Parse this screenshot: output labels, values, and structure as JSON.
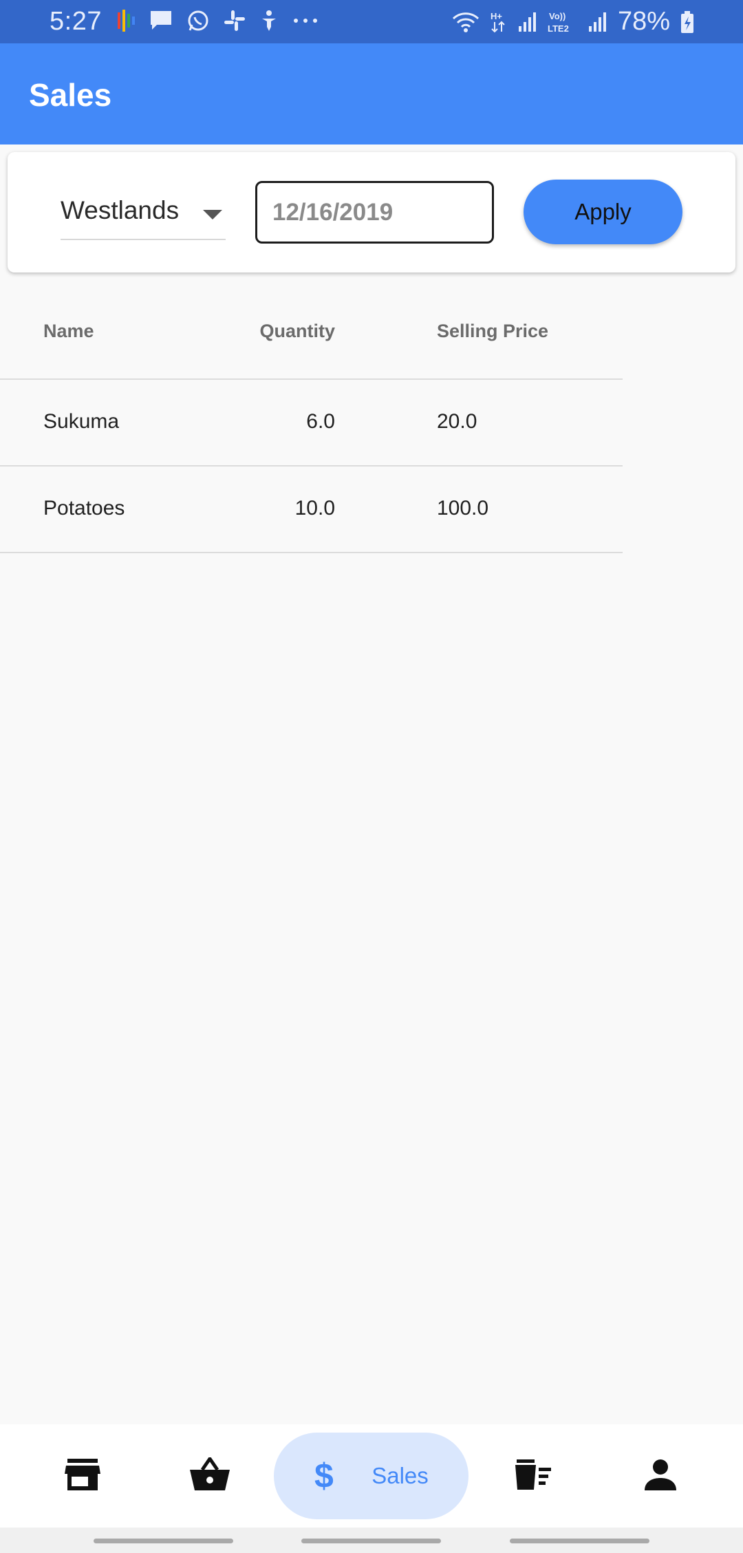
{
  "status_bar": {
    "time": "5:27",
    "battery": "78%",
    "left_icons": [
      "multicolor-app-icon",
      "message-icon",
      "whatsapp-icon",
      "slack-icon",
      "accessibility-icon",
      "more-icon"
    ],
    "right_icons": [
      "wifi-icon",
      "h-plus-icon",
      "signal-icon",
      "volte-icon",
      "signal-icon",
      "battery-charging-icon"
    ]
  },
  "app_bar": {
    "title": "Sales"
  },
  "filters": {
    "location": "Westlands",
    "date": "12/16/2019",
    "apply_label": "Apply"
  },
  "table": {
    "headers": [
      "Name",
      "Quantity",
      "Selling Price"
    ],
    "rows": [
      [
        "Sukuma",
        "6.0",
        "20.0"
      ],
      [
        "Potatoes",
        "10.0",
        "100.0"
      ]
    ]
  },
  "bottom_nav": {
    "items": [
      {
        "icon": "store-icon"
      },
      {
        "icon": "basket-icon"
      },
      {
        "icon": "dollar-icon",
        "label": "Sales",
        "active": true
      },
      {
        "icon": "inventory-icon"
      },
      {
        "icon": "person-icon"
      }
    ]
  },
  "colors": {
    "status_bar": "#3367c9",
    "primary": "#4389f8",
    "active_tab_bg": "#dae7fd",
    "background": "#f9f9f9"
  }
}
